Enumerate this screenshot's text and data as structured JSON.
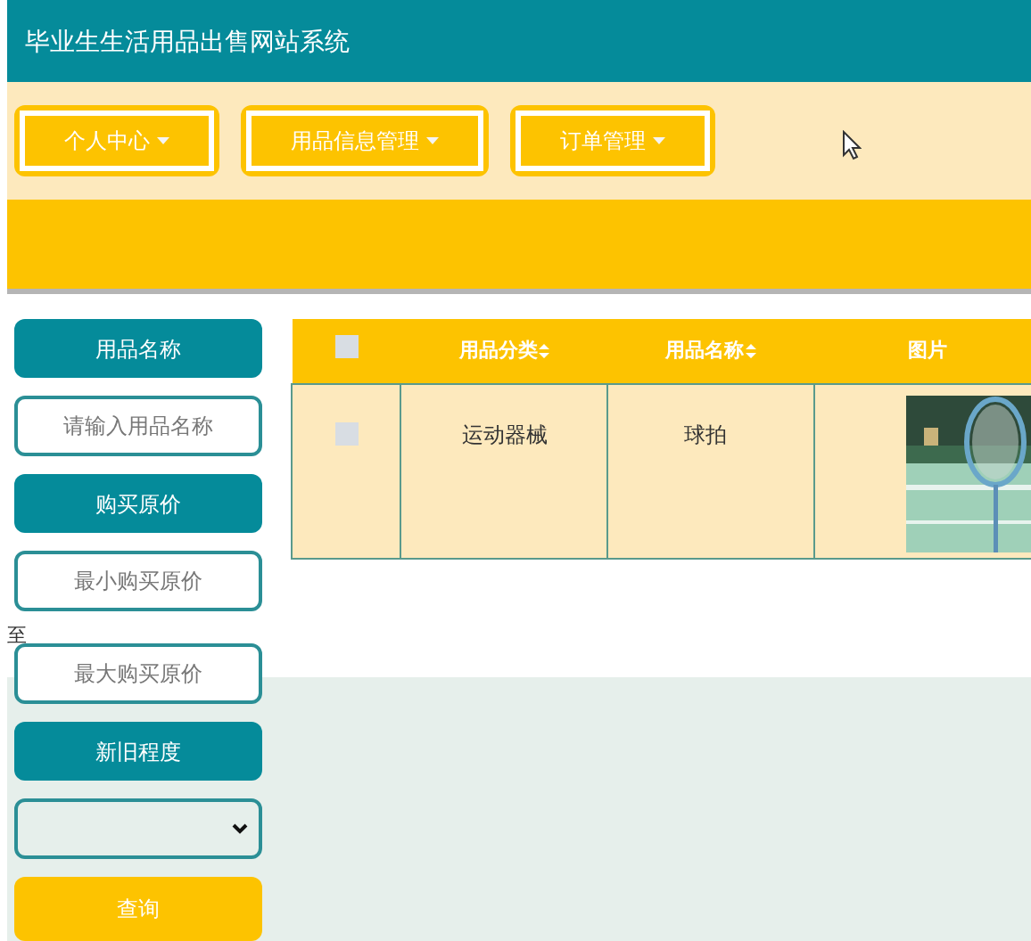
{
  "header": {
    "title": "毕业生生活用品出售网站系统"
  },
  "nav": [
    {
      "label": "个人中心"
    },
    {
      "label": "用品信息管理"
    },
    {
      "label": "订单管理"
    }
  ],
  "sidebar": [
    {
      "kind": "label",
      "text": "用品名称"
    },
    {
      "kind": "input",
      "placeholder": "请输入用品名称"
    },
    {
      "kind": "label",
      "text": "购买原价"
    },
    {
      "kind": "input",
      "placeholder": "最小购买原价"
    },
    {
      "kind": "separator",
      "text": "至"
    },
    {
      "kind": "input",
      "placeholder": "最大购买原价"
    },
    {
      "kind": "label",
      "text": "新旧程度"
    },
    {
      "kind": "select"
    },
    {
      "kind": "button",
      "text": "查询"
    }
  ],
  "table": {
    "columns": [
      {
        "kind": "checkbox",
        "checked": false
      },
      {
        "kind": "text",
        "label": "用品分类",
        "sortable": true
      },
      {
        "kind": "text",
        "label": "用品名称",
        "sortable": true
      },
      {
        "kind": "text",
        "label": "图片",
        "sortable": false
      }
    ],
    "rows": [
      {
        "checked": false,
        "category": "运动器械",
        "name": "球拍"
      }
    ]
  }
}
